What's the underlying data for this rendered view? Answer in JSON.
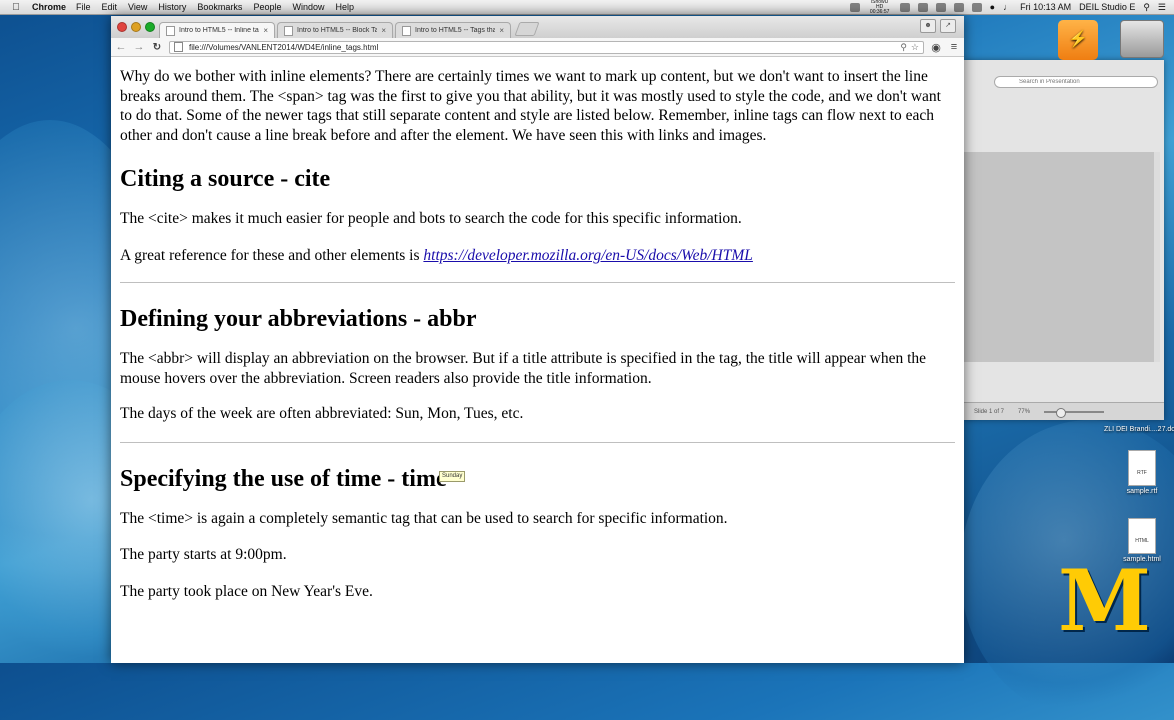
{
  "menubar": {
    "app": "Chrome",
    "items": [
      "File",
      "Edit",
      "View",
      "History",
      "Bookmarks",
      "People",
      "Window",
      "Help"
    ],
    "clock": "Fri 10:13 AM",
    "user": "DEIL Studio E",
    "showit": "iShowU HD 00:36:57"
  },
  "browser": {
    "tabs": [
      {
        "label": "Intro to HTML5 -- Inline ta"
      },
      {
        "label": "Intro to HTML5 -- Block Ta"
      },
      {
        "label": "Intro to HTML5 -- Tags tha"
      }
    ],
    "url": "file:///Volumes/VANLENT2014/WD4E/inline_tags.html"
  },
  "page": {
    "intro": "Why do we bother with inline elements? There are certainly times we want to mark up content, but we don't want to insert the line breaks around them. The <span> tag was the first to give you that ability, but it was mostly used to style the code, and we don't want to do that. Some of the newer tags that still separate content and style are listed below. Remember, inline tags can flow next to each other and don't cause a line break before and after the element. We have seen this with links and images.",
    "cite": {
      "heading": "Citing a source - cite",
      "p1": "The <cite> makes it much easier for people and bots to search the code for this specific information.",
      "p2_prefix": "A great reference for these and other elements is ",
      "link": "https://developer.mozilla.org/en-US/docs/Web/HTML"
    },
    "abbr": {
      "heading": "Defining your abbreviations - abbr",
      "p1": "The <abbr> will display an abbreviation on the browser. But if a title attribute is specified in the tag, the title will appear when the mouse hovers over the abbreviation. Screen readers also provide the title information.",
      "p2": "The days of the week are often abbreviated: Sun, Mon, Tues, etc.",
      "tooltip": "Sunday"
    },
    "time": {
      "heading": "Specifying the use of time - time",
      "p1": "The <time> is again a completely semantic tag that can be used to search for specific information.",
      "p2": "The party starts at 9:00pm.",
      "p3": "The party took place on New Year's Eve."
    }
  },
  "keynote": {
    "search_placeholder": "Search in Presentation",
    "slide_label": "Slide 1 of 7",
    "zoom": "77%"
  },
  "desktop": {
    "icons": [
      {
        "label": "ZLI DEI Brandi....27.docx"
      },
      {
        "label": "sample.rtf",
        "badge": "RTF"
      },
      {
        "label": "sample.html",
        "badge": "HTML"
      }
    ],
    "logo": "M"
  }
}
